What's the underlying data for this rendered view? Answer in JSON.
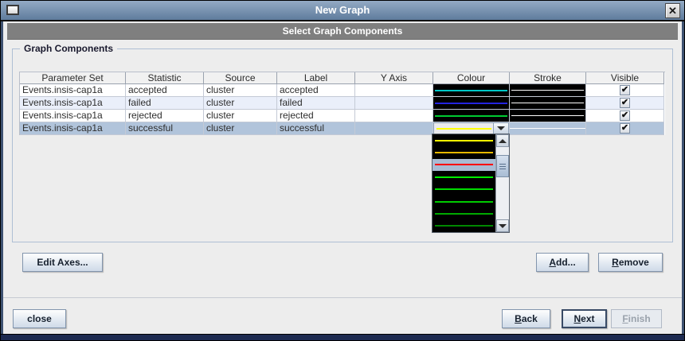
{
  "window": {
    "title": "New Graph",
    "close_glyph": "✕"
  },
  "wizard_header": {
    "title": "Select Graph Components"
  },
  "group": {
    "title": "Graph Components"
  },
  "table": {
    "columns": [
      "Parameter Set",
      "Statistic",
      "Source",
      "Label",
      "Y Axis",
      "Colour",
      "Stroke",
      "Visible"
    ],
    "rows": [
      {
        "parameter_set": "Events.insis-cap1a",
        "statistic": "accepted",
        "source": "cluster",
        "label": "accepted",
        "y_axis": "",
        "colour": "#00c8c8",
        "stroke_colour": "#ffffff",
        "visible": true,
        "selected": false
      },
      {
        "parameter_set": "Events.insis-cap1a",
        "statistic": "failed",
        "source": "cluster",
        "label": "failed",
        "y_axis": "",
        "colour": "#2424e0",
        "stroke_colour": "#ffffff",
        "visible": true,
        "selected": false
      },
      {
        "parameter_set": "Events.insis-cap1a",
        "statistic": "rejected",
        "source": "cluster",
        "label": "rejected",
        "y_axis": "",
        "colour": "#00cc33",
        "stroke_colour": "#ffffff",
        "visible": true,
        "selected": false
      },
      {
        "parameter_set": "Events.insis-cap1a",
        "statistic": "successful",
        "source": "cluster",
        "label": "successful",
        "y_axis": "",
        "colour": "#ffff00",
        "stroke_colour": "#ffffff",
        "visible": true,
        "selected": true,
        "colour_editor_open": true
      }
    ]
  },
  "colour_dropdown": {
    "open": true,
    "selected_value": "#ffff00",
    "options": [
      {
        "color": "#ffff00",
        "highlighted": false
      },
      {
        "color": "#e6b800",
        "highlighted": false
      },
      {
        "color": "#ff0000",
        "highlighted": true
      },
      {
        "color": "#00ee00",
        "highlighted": false
      },
      {
        "color": "#00dd00",
        "highlighted": false
      },
      {
        "color": "#00cc00",
        "highlighted": false
      },
      {
        "color": "#00aa00",
        "highlighted": false
      },
      {
        "color": "#008800",
        "highlighted": false
      }
    ]
  },
  "buttons": {
    "edit_axes": "Edit Axes...",
    "add": {
      "mnemonic": "A",
      "rest": "dd..."
    },
    "remove": {
      "mnemonic": "R",
      "rest": "emove"
    },
    "close": "close",
    "back": {
      "mnemonic": "B",
      "rest": "ack"
    },
    "next": {
      "mnemonic": "N",
      "rest": "ext"
    },
    "finish": {
      "mnemonic": "F",
      "rest": "inish"
    }
  },
  "icons": {
    "check_glyph": "✔"
  },
  "colors": {
    "selection": "#b1c4db",
    "alt_row": "#eaeffa",
    "swatch_bg": "#000000",
    "titlebar_top": "#93aac4",
    "titlebar_bottom": "#5f7c9d",
    "step_header_bg": "#7f7f7f",
    "bottom_bar": "#1d2a50"
  }
}
